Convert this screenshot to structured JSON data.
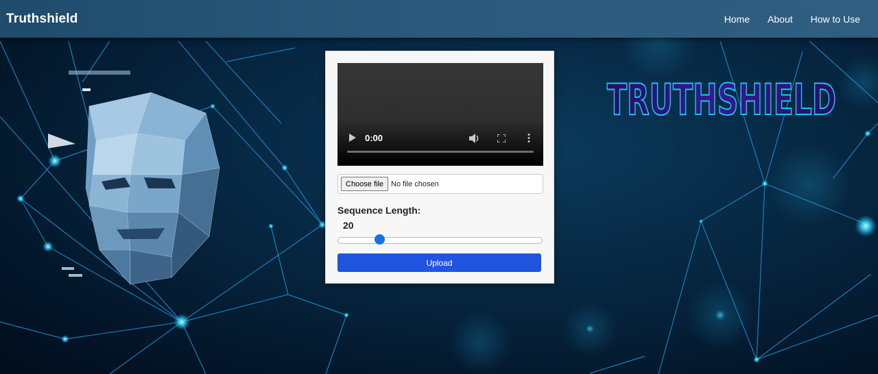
{
  "navbar": {
    "brand": "Truthshield",
    "links": [
      "Home",
      "About",
      "How to Use"
    ]
  },
  "hero": {
    "logo_text": "TRUTHSHIELD"
  },
  "upload_card": {
    "video": {
      "time": "0:00"
    },
    "file_input": {
      "button_label": "Choose file",
      "status": "No file chosen"
    },
    "sequence": {
      "label": "Sequence Length:",
      "value": "20",
      "fraction": 0.19
    },
    "upload_label": "Upload"
  },
  "colors": {
    "navbar": "#2c5a7c",
    "upload_button": "#1f55de",
    "slider_thumb": "#1373e6",
    "logo_fill": "#2a0f5e",
    "logo_glow": "#19c7ff"
  },
  "icons": [
    "play-icon",
    "volume-icon",
    "fullscreen-icon",
    "more-options-icon"
  ]
}
